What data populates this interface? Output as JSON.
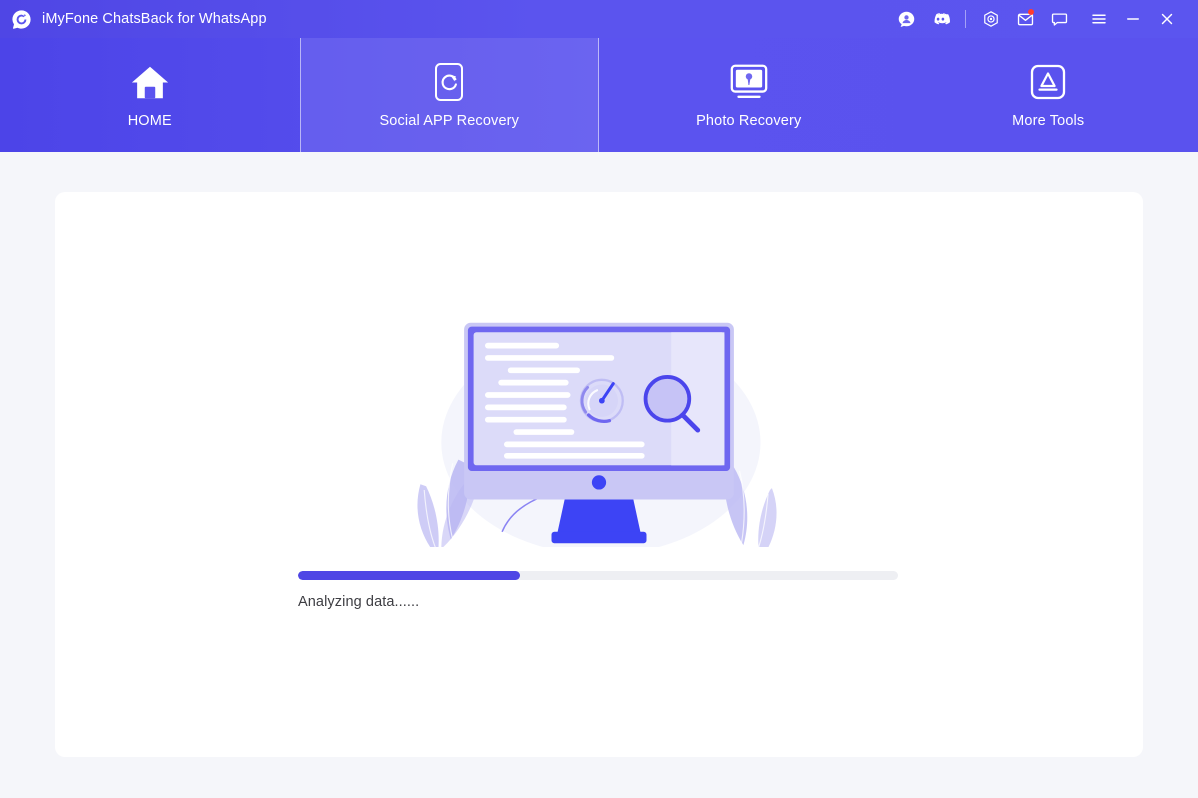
{
  "window": {
    "title": "iMyFone ChatsBack for WhatsApp",
    "logo_icon": "chatsback-circle-c-logo",
    "accent_color": "#4f46e5",
    "titlebar_gradient_from": "#4f46e5",
    "titlebar_gradient_to": "#5b55ef",
    "background_color": "#f5f6fa",
    "card_color": "#ffffff"
  },
  "titlebar_actions": [
    {
      "name": "account-avatar-icon",
      "label": "Account"
    },
    {
      "name": "discord-icon",
      "label": "Discord"
    },
    {
      "name": "separator",
      "label": ""
    },
    {
      "name": "target-circle-icon",
      "label": "Feedback"
    },
    {
      "name": "mail-envelope-icon",
      "label": "Messages",
      "badge": true
    },
    {
      "name": "chat-bubble-icon",
      "label": "Support Chat"
    },
    {
      "name": "hamburger-menu-icon",
      "label": "Menu"
    },
    {
      "name": "minimize-icon",
      "label": "Minimize"
    },
    {
      "name": "close-icon",
      "label": "Close"
    }
  ],
  "nav": {
    "tabs": [
      {
        "label": "HOME",
        "icon": "home-icon",
        "active": false
      },
      {
        "label": "Social APP Recovery",
        "icon": "phone-refresh-icon",
        "active": true
      },
      {
        "label": "Photo Recovery",
        "icon": "monitor-photo-icon",
        "active": false
      },
      {
        "label": "More Tools",
        "icon": "app-store-icon",
        "active": false
      }
    ]
  },
  "main": {
    "illustration": "desktop-monitor-scanning-illustration",
    "progress": {
      "percent": 37,
      "percent_label": "37%",
      "track_color": "#eeeff3",
      "fill_color": "#4f46e5"
    },
    "status_text": "Analyzing data......"
  }
}
